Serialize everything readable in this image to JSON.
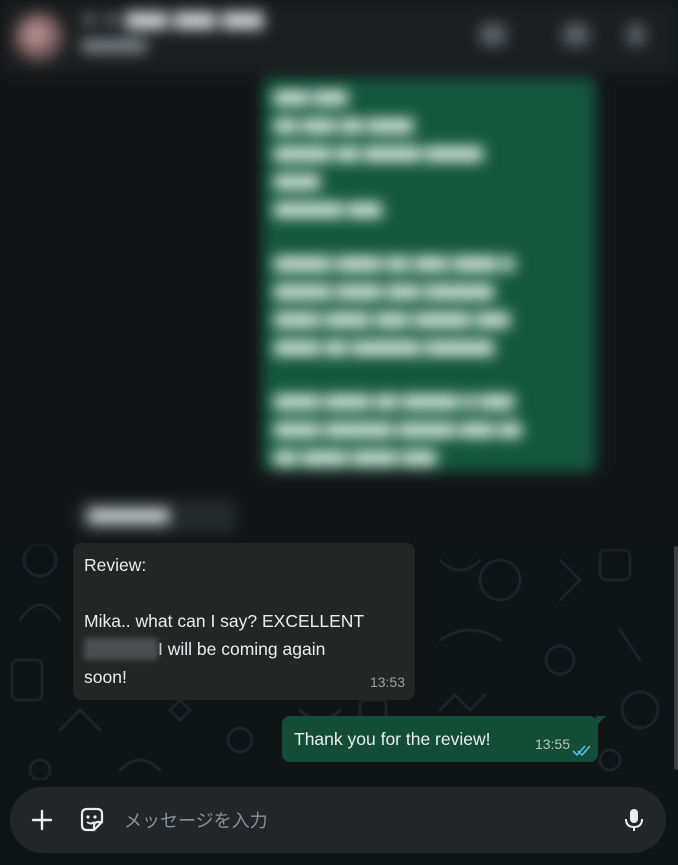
{
  "header": {
    "title": "★ ★ ▇▇▇ ▇▇▇ ▇▇▇",
    "subtitle": "▇▇▇▇▇▇▇"
  },
  "blurred": {
    "bubble_paragraphs": [
      "▇▇▇ ▇▇▇\n▇▇ ▇▇▇ ▇▇ ▇▇▇▇\n▇▇▇▇▇ ▇▇ ▇▇▇▇▇ ▇▇▇▇▇\n▇▇▇▇\n▇▇▇▇▇▇ ▇▇▇",
      "▇▇▇▇▇ ▇▇▇▇ ▇▇ ▇▇▇ ▇▇▇▇ ▇\n▇▇▇▇▇ ▇▇▇▇ ▇▇▇ ▇▇▇▇▇▇\n▇▇▇▇ ▇▇▇▇ ▇▇▇ ▇▇▇▇▇ ▇▇▇\n▇▇▇▇ ▇▇ ▇▇▇▇▇▇ ▇▇▇▇▇▇",
      "▇▇▇▇ ▇▇▇▇ ▇▇ ▇▇▇▇▇ ▇ ▇▇▇\n▇▇▇▇ ▇▇▇▇▇▇ ▇▇▇▇▇ ▇▇▇ ▇▇\n▇▇ ▇▇▇▇ ▇▇▇▇ ▇▇▇"
    ],
    "small_message": "▇▇▇▇▇▇▇"
  },
  "messages": {
    "incoming": {
      "line1": "Review:",
      "line2": "Mika.. what can I say? EXCELLENT",
      "line3_after_redaction": "I will be coming again",
      "line4": "soon!",
      "time": "13:53"
    },
    "outgoing": {
      "text": "Thank you for the review!",
      "time": "13:55",
      "status_icon": "double-check-read-icon"
    }
  },
  "composer": {
    "placeholder": "メッセージを入力"
  },
  "colors": {
    "outgoing_bubble": "#144d37",
    "incoming_bubble": "#242626",
    "read_ticks": "#53bdeb"
  }
}
